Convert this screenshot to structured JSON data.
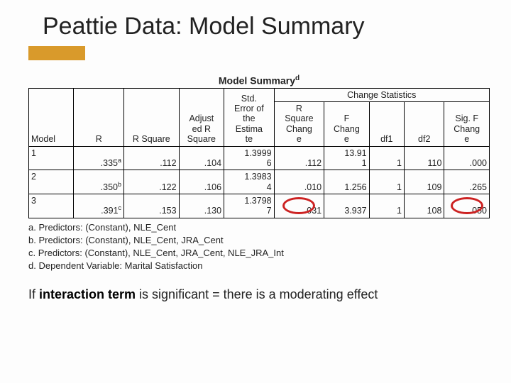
{
  "title": "Peattie Data: Model Summary",
  "table_title": "Model Summary",
  "table_title_sup": "d",
  "headers": {
    "model": "Model",
    "r": "R",
    "rsq": "R Square",
    "adjrsq": "Adjusted R Square",
    "stderr": "Std. Error of the Estimate",
    "change_group": "Change Statistics",
    "rsqch": "R Square Change",
    "fch": "F Change",
    "df1": "df1",
    "df2": "df2",
    "sigf": "Sig. F Change"
  },
  "rows": [
    {
      "model": "1",
      "r": ".335",
      "rsup": "a",
      "rsq": ".112",
      "adjrsq": ".104",
      "stderr": "1.39996",
      "rsqch": ".112",
      "fch": "13.911",
      "df1": "1",
      "df2": "110",
      "sigf": ".000"
    },
    {
      "model": "2",
      "r": ".350",
      "rsup": "b",
      "rsq": ".122",
      "adjrsq": ".106",
      "stderr": "1.39834",
      "rsqch": ".010",
      "fch": "1.256",
      "df1": "1",
      "df2": "109",
      "sigf": ".265"
    },
    {
      "model": "3",
      "r": ".391",
      "rsup": "c",
      "rsq": ".153",
      "adjrsq": ".130",
      "stderr": "1.37987",
      "rsqch": ".031",
      "fch": "3.937",
      "df1": "1",
      "df2": "108",
      "sigf": ".050"
    }
  ],
  "notes": {
    "a": "a. Predictors: (Constant), NLE_Cent",
    "b": "b. Predictors: (Constant), NLE_Cent, JRA_Cent",
    "c": "c. Predictors: (Constant), NLE_Cent, JRA_Cent, NLE_JRA_Int",
    "d": "d. Dependent Variable: Marital Satisfaction"
  },
  "interp_pre": "If ",
  "interp_bold": "interaction term",
  "interp_post": " is significant = there is a moderating effect",
  "chart_data": {
    "type": "table",
    "title": "Model Summary",
    "columns": [
      "Model",
      "R",
      "R Square",
      "Adjusted R Square",
      "Std. Error of the Estimate",
      "R Square Change",
      "F Change",
      "df1",
      "df2",
      "Sig. F Change"
    ],
    "rows": [
      [
        "1",
        0.335,
        0.112,
        0.104,
        1.39996,
        0.112,
        13.911,
        1,
        110,
        0.0
      ],
      [
        "2",
        0.35,
        0.122,
        0.106,
        1.39834,
        0.01,
        1.256,
        1,
        109,
        0.265
      ],
      [
        "3",
        0.391,
        0.153,
        0.13,
        1.37987,
        0.031,
        3.937,
        1,
        108,
        0.05
      ]
    ],
    "highlighted": {
      "row_index": 2,
      "columns": [
        "R Square Change",
        "Sig. F Change"
      ],
      "values": [
        0.031,
        0.05
      ]
    }
  }
}
